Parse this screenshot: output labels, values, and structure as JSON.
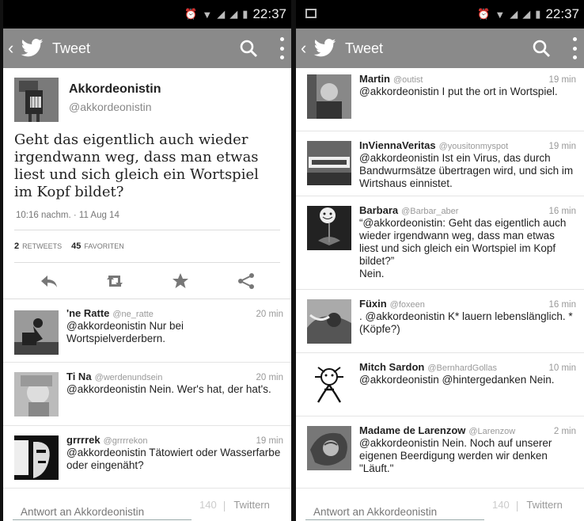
{
  "status": {
    "time": "22:37"
  },
  "left": {
    "app_title": "Tweet",
    "tweet": {
      "name": "Akkordeonistin",
      "handle": "@akkordeonistin",
      "text": "Geht das eigentlich auch wieder irgendwann weg, dass man etwas liest und sich gleich ein Wortspiel im Kopf bildet?",
      "date": "10:16 nachm. · 11 Aug 14",
      "retweets_count": "2",
      "retweets_label": "RETWEETS",
      "favorites_count": "45",
      "favorites_label": "FAVORITEN"
    },
    "actions": [
      "reply-icon",
      "retweet-icon",
      "favorite-icon",
      "share-icon"
    ],
    "replies": [
      {
        "name": "'ne Ratte",
        "handle": "@ne_ratte",
        "time": "20 min",
        "text": "@akkordeonistin Nur bei Wortspielverderbern."
      },
      {
        "name": "Ti Na",
        "handle": "@werdenundsein",
        "time": "20 min",
        "text": "@akkordeonistin Nein. Wer's hat, der hat's."
      },
      {
        "name": "grrrrek",
        "handle": "@grrrrekon",
        "time": "19 min",
        "text": "@akkordeonistin Tätowiert oder Wasserfarbe oder eingenäht?"
      }
    ],
    "compose": {
      "placeholder": "Antwort an Akkordeonistin",
      "count": "140",
      "button": "Twittern"
    }
  },
  "right": {
    "app_title": "Tweet",
    "replies": [
      {
        "name": "Martin",
        "handle": "@outist",
        "time": "19 min",
        "text": "@akkordeonistin I put the ort in Wortspiel."
      },
      {
        "name": "InViennaVeritas",
        "handle": "@yousitonmyspot",
        "time": "19 min",
        "text": "@akkordeonistin Ist ein Virus, das durch Bandwurmsätze übertragen wird, und sich im Wirtshaus einnistet."
      },
      {
        "name": "Barbara",
        "handle": "@Barbar_aber",
        "time": "16 min",
        "text": "“@akkordeonistin: Geht das eigentlich auch wieder irgendwann weg, dass man etwas liest und sich gleich ein Wortspiel im Kopf bildet?”\nNein."
      },
      {
        "name": "Füxin",
        "handle": "@foxeen",
        "time": "16 min",
        "text": ". @akkordeonistin K* lauern lebenslänglich. *(Köpfe?)"
      },
      {
        "name": "Mitch Sardon",
        "handle": "@BernhardGollas",
        "time": "10 min",
        "text": "@akkordeonistin @hintergedanken Nein."
      },
      {
        "name": "Madame de Larenzow",
        "handle": "@Larenzow",
        "time": "2 min",
        "text": "@akkordeonistin Nein. Noch auf unserer eigenen Beerdigung werden wir denken \"Läuft.\""
      }
    ],
    "compose": {
      "placeholder": "Antwort an Akkordeonistin",
      "count": "140",
      "button": "Twittern"
    }
  }
}
